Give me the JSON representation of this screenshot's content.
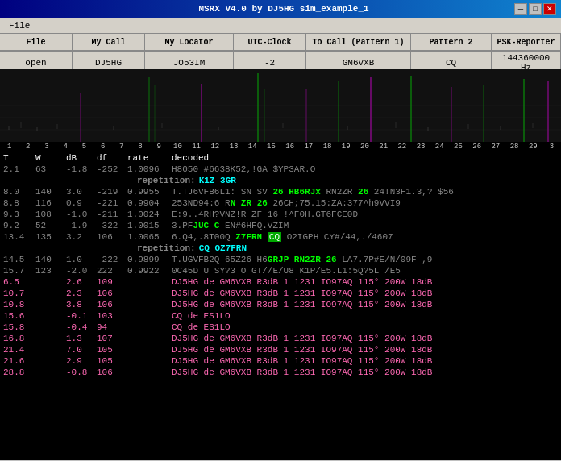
{
  "titleBar": {
    "title": "MSRX V4.0 by DJ5HG  sim_example_1",
    "minBtn": "─",
    "maxBtn": "□",
    "closeBtn": "✕"
  },
  "menuBar": {
    "items": [
      "File",
      "My Call",
      "My Locator",
      "UTC-Clock",
      "To Call (Pattern 1)",
      "Pattern 2",
      "PSK-Reporter"
    ]
  },
  "toolbar": {
    "labels": [
      "File",
      "My Call",
      "My Locator",
      "UTC-Clock",
      "To Call (Pattern 1)",
      "Pattern 2",
      "PSK-Reporter"
    ],
    "values": [
      "open",
      "DJ5HG",
      "JO53IM",
      "-2",
      "GM6VXB",
      "CQ",
      "144360000 Hz"
    ]
  },
  "freqScale": {
    "ticks": [
      "1",
      "2",
      "3",
      "4",
      "5",
      "6",
      "7",
      "8",
      "9",
      "10",
      "11",
      "12",
      "13",
      "14",
      "15",
      "16",
      "17",
      "18",
      "19",
      "20",
      "21",
      "22",
      "23",
      "24",
      "25",
      "26",
      "27",
      "28",
      "29",
      "3"
    ]
  },
  "colHeaders": {
    "t": "T",
    "w": "W",
    "db": "dB",
    "df": "df",
    "rate": "rate",
    "decoded": "decoded"
  },
  "decodes": [
    {
      "t": "2.1",
      "w": "63",
      "db": "-1.8",
      "df": "-252",
      "rate": "1.0096",
      "text": "H8050 #6638K52,!GA $YP3AR.O",
      "color": "gray",
      "repetition": "K1Z 3GR"
    },
    {
      "t": "8.0",
      "w": "140",
      "db": "3.0",
      "df": "-219",
      "rate": "0.9955",
      "text": "T.TJ6VFB6L1: SN SV 26 HB6RJx RN2ZR 26 24!N3F1.3,? $56",
      "color": "gray",
      "special": true
    },
    {
      "t": "8.8",
      "w": "116",
      "db": "0.9",
      "df": "-221",
      "rate": "0.9904",
      "text": "253ND94:6 RN ZR 26 26CH;75.15:ZA:377^h9VVI9",
      "color": "gray"
    },
    {
      "t": "9.3",
      "w": "108",
      "db": "-1.0",
      "df": "-211",
      "rate": "1.0024",
      "text": "E:9..4RH?VNZ!R ZF 16 !^F0H.GT6FCE0D",
      "color": "gray"
    },
    {
      "t": "9.2",
      "w": "52",
      "db": "-1.9",
      "df": "-322",
      "rate": "1.0015",
      "text": "3.PFJUC C EN#6HFQ.VZIM",
      "color": "gray"
    },
    {
      "t": "13.4",
      "w": "135",
      "db": "3.2",
      "df": "106",
      "rate": "1.0065",
      "text": "6.Q4,.8T00Q Z7FRN CQ O2IGPH CY#/44,./4607",
      "color": "gray",
      "special2": true,
      "repetition2": "CQ OZ7FRN"
    },
    {
      "t": "14.5",
      "w": "140",
      "db": "1.0",
      "df": "-222",
      "rate": "0.9899",
      "text": "T.UGVFB2Q 65Z26 H6GRJP RN2ZR 26 LA7.7P#E/N/09F ,9",
      "color": "gray"
    },
    {
      "t": "15.7",
      "w": "123",
      "db": "-2.0",
      "df": "222",
      "rate": "0.9922",
      "text": "0C45D U SY?3 O GT//E/U8 K1P/E5.L1:5Q?5L /E5",
      "color": "gray"
    },
    {
      "t": "6.5",
      "w": "",
      "db": "2.6",
      "df": "109",
      "rate": "",
      "text": "DJ5HG de GM6VXB R3dB 1 1231 IO97AQ 115° 200W 18dB",
      "color": "pink"
    },
    {
      "t": "10.7",
      "w": "",
      "db": "2.3",
      "df": "106",
      "rate": "",
      "text": "DJ5HG de GM6VXB R3dB 1 1231 IO97AQ 115° 200W 18dB",
      "color": "pink"
    },
    {
      "t": "10.8",
      "w": "",
      "db": "3.8",
      "df": "106",
      "rate": "",
      "text": "DJ5HG de GM6VXB R3dB 1 1231 IO97AQ 115° 200W 18dB",
      "color": "pink"
    },
    {
      "t": "15.6",
      "w": "",
      "db": "-0.1",
      "df": "103",
      "rate": "",
      "text": "CQ de ES1LO",
      "color": "pink"
    },
    {
      "t": "15.8",
      "w": "",
      "db": "-0.4",
      "df": "94",
      "rate": "",
      "text": "CQ de ES1LO",
      "color": "pink"
    },
    {
      "t": "16.8",
      "w": "",
      "db": "1.3",
      "df": "107",
      "rate": "",
      "text": "DJ5HG de GM6VXB R3dB 1 1231 IO97AQ 115° 200W 18dB",
      "color": "pink"
    },
    {
      "t": "21.4",
      "w": "",
      "db": "7.0",
      "df": "105",
      "rate": "",
      "text": "DJ5HG de GM6VXB R3dB 1 1231 IO97AQ 115° 200W 18dB",
      "color": "pink"
    },
    {
      "t": "21.6",
      "w": "",
      "db": "2.9",
      "df": "105",
      "rate": "",
      "text": "DJ5HG de GM6VXB R3dB 1 1231 IO97AQ 115° 200W 18dB",
      "color": "pink"
    },
    {
      "t": "28.8",
      "w": "",
      "db": "-0.8",
      "df": "106",
      "rate": "",
      "text": "DJ5HG de GM6VXB R3dB 1 1231 IO97AQ 115° 200W 18dB",
      "color": "pink"
    }
  ]
}
